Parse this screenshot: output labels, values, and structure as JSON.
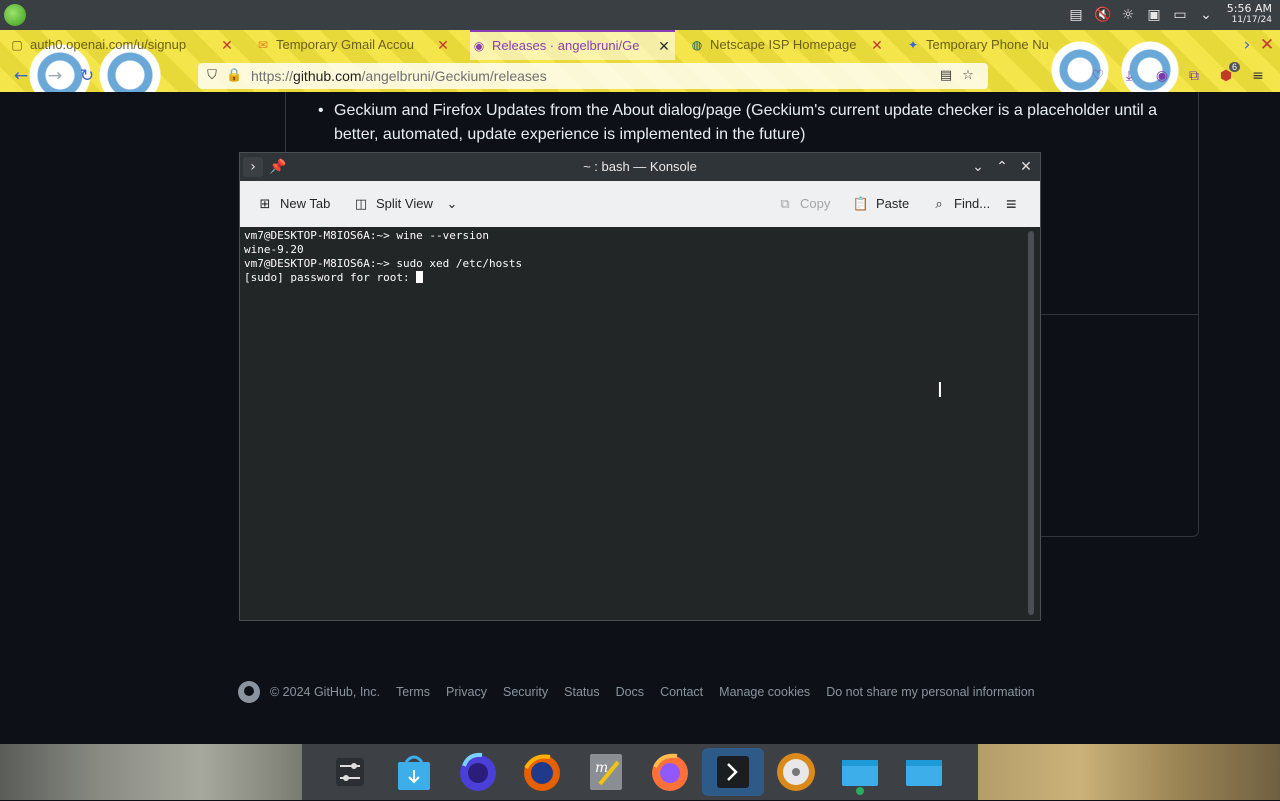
{
  "panel": {
    "time": "5:56 AM",
    "date": "11/17/24",
    "tray_icons": [
      "clipboard-icon",
      "volume-muted-icon",
      "brightness-icon",
      "save-icon",
      "screen-icon",
      "chevron-down-icon"
    ]
  },
  "browser": {
    "tabs": [
      {
        "label": "auth0.openai.com/u/signup",
        "icon": "page-icon",
        "active": false
      },
      {
        "label": "Temporary Gmail Accou",
        "icon": "mail-icon",
        "active": false
      },
      {
        "label": "Releases · angelbruni/Ge",
        "icon": "github-icon",
        "active": true
      },
      {
        "label": "Netscape ISP Homepage",
        "icon": "netscape-icon",
        "active": false
      },
      {
        "label": "Temporary Phone Nu",
        "icon": "temp-icon",
        "active": false
      }
    ],
    "url_prefix": "https://",
    "url_domain": "github.com",
    "url_path": "/angelbruni/Geckium/releases",
    "extension_badge": "6"
  },
  "page": {
    "bullet_text": "Geckium and Firefox Updates from the About dialog/page (Geckium's current update checker is a placeholder until a better, automated, update experience is implemented in the future)",
    "footer": {
      "copyright": "© 2024 GitHub, Inc.",
      "links": [
        "Terms",
        "Privacy",
        "Security",
        "Status",
        "Docs",
        "Contact",
        "Manage cookies",
        "Do not share my personal information"
      ]
    }
  },
  "konsole": {
    "title": "~ : bash — Konsole",
    "toolbar": {
      "new_tab": "New Tab",
      "split_view": "Split View",
      "copy": "Copy",
      "paste": "Paste",
      "find": "Find..."
    },
    "terminal": {
      "line1": "vm7@DESKTOP-M8IOS6A:~> wine --version",
      "line2": "wine-9.20",
      "line3": "vm7@DESKTOP-M8IOS6A:~> sudo xed /etc/hosts",
      "line4": "[sudo] password for root: "
    }
  },
  "dock": {
    "items": [
      "settings-icon",
      "store-icon",
      "firefox-nightly-icon",
      "firefox-icon",
      "xed-editor-icon",
      "firefox-dev-icon",
      "konsole-icon",
      "disk-icon",
      "file-manager-new-icon",
      "file-manager-icon"
    ],
    "active_index": 6
  },
  "colors": {
    "page_bg": "#0d1117",
    "terminal_bg": "#232627",
    "accent": "#2e5a88"
  }
}
